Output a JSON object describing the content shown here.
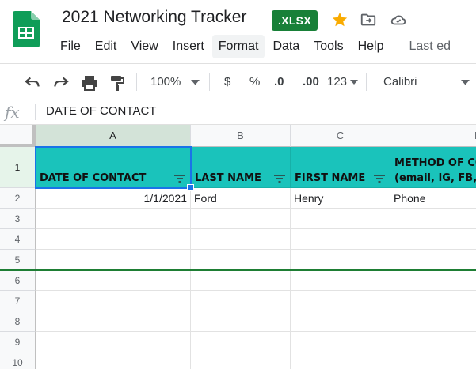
{
  "document": {
    "title": "2021 Networking Tracker",
    "badge": ".XLSX"
  },
  "menu": {
    "items": [
      "File",
      "Edit",
      "View",
      "Insert",
      "Format",
      "Data",
      "Tools",
      "Help"
    ],
    "active": "Format",
    "last_edit": "Last ed"
  },
  "toolbar": {
    "zoom": "100%",
    "currency": "$",
    "percent": "%",
    "decrease_decimal": ".0",
    "increase_decimal": ".00",
    "number_format": "123",
    "font": "Calibri"
  },
  "formula_bar": {
    "fx_label": "fx",
    "value": "DATE OF CONTACT"
  },
  "grid": {
    "columns": [
      "A",
      "B",
      "C",
      "D"
    ],
    "rows": [
      "1",
      "2",
      "3",
      "4",
      "5",
      "6",
      "7",
      "8",
      "9",
      "10"
    ],
    "header_row": [
      "DATE OF CONTACT",
      "LAST NAME",
      "FIRST NAME",
      "METHOD OF CO\n(email, IG, FB, T"
    ],
    "data_rows": [
      [
        "1/1/2021",
        "Ford",
        "Henry",
        "Phone"
      ]
    ],
    "selected_cell": "A1",
    "header_color": "#1ac3bb"
  },
  "colors": {
    "accent": "#1a73e8",
    "brand_green": "#188038",
    "star": "#f9ab00"
  }
}
